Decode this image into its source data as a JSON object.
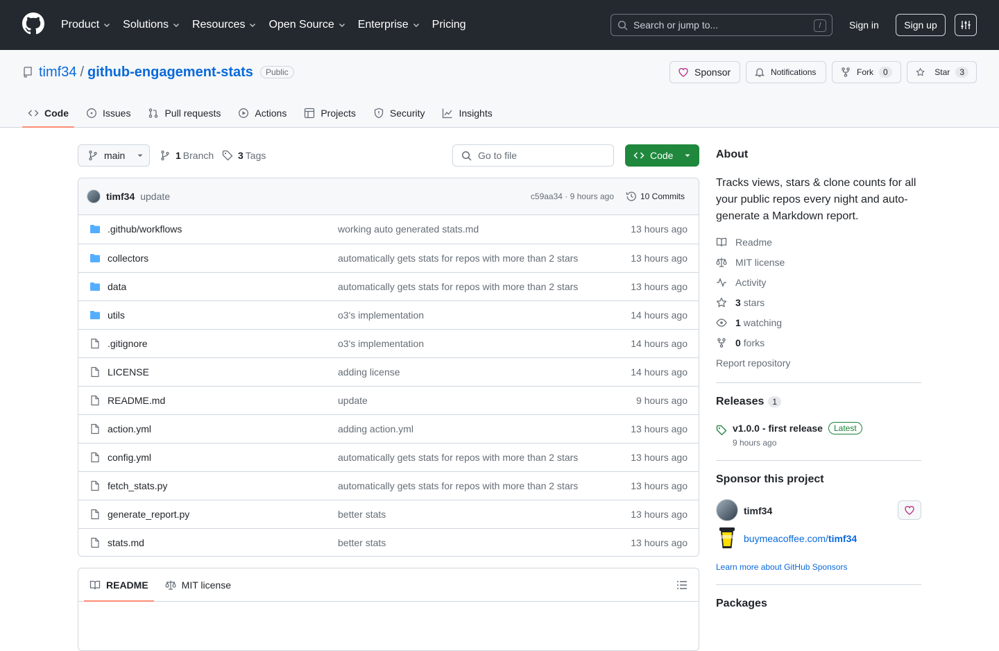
{
  "header": {
    "nav": [
      {
        "label": "Product",
        "has_menu": true
      },
      {
        "label": "Solutions",
        "has_menu": true
      },
      {
        "label": "Resources",
        "has_menu": true
      },
      {
        "label": "Open Source",
        "has_menu": true
      },
      {
        "label": "Enterprise",
        "has_menu": true
      },
      {
        "label": "Pricing",
        "has_menu": false
      }
    ],
    "search_placeholder": "Search or jump to...",
    "search_shortcut": "/",
    "sign_in": "Sign in",
    "sign_up": "Sign up"
  },
  "repo": {
    "owner": "timf34",
    "separator": "/",
    "name": "github-engagement-stats",
    "visibility": "Public",
    "sponsor_label": "Sponsor",
    "notifications_label": "Notifications",
    "fork_label": "Fork",
    "fork_count": "0",
    "star_label": "Star",
    "star_count": "3"
  },
  "tabs": [
    {
      "label": "Code",
      "icon": "code-icon",
      "active": true
    },
    {
      "label": "Issues",
      "icon": "issue-icon",
      "active": false
    },
    {
      "label": "Pull requests",
      "icon": "pull-request-icon",
      "active": false
    },
    {
      "label": "Actions",
      "icon": "play-icon",
      "active": false
    },
    {
      "label": "Projects",
      "icon": "table-icon",
      "active": false
    },
    {
      "label": "Security",
      "icon": "shield-icon",
      "active": false
    },
    {
      "label": "Insights",
      "icon": "graph-icon",
      "active": false
    }
  ],
  "toolbar": {
    "branch": "main",
    "branch_count": "1",
    "branch_label": "Branch",
    "tag_count": "3",
    "tag_label": "Tags",
    "go_to_file": "Go to file",
    "code_button": "Code"
  },
  "latest_commit": {
    "author": "timf34",
    "message": "update",
    "hash_and_time": "c59aa34 · 9 hours ago",
    "commits": "10 Commits"
  },
  "files": [
    {
      "name": ".github/workflows",
      "type": "dir",
      "message": "working auto generated stats.md",
      "age": "13 hours ago"
    },
    {
      "name": "collectors",
      "type": "dir",
      "message": "automatically gets stats for repos with more than 2 stars",
      "age": "13 hours ago"
    },
    {
      "name": "data",
      "type": "dir",
      "message": "automatically gets stats for repos with more than 2 stars",
      "age": "13 hours ago"
    },
    {
      "name": "utils",
      "type": "dir",
      "message": "o3's implementation",
      "age": "14 hours ago"
    },
    {
      "name": ".gitignore",
      "type": "file",
      "message": "o3's implementation",
      "age": "14 hours ago"
    },
    {
      "name": "LICENSE",
      "type": "file",
      "message": "adding license",
      "age": "14 hours ago"
    },
    {
      "name": "README.md",
      "type": "file",
      "message": "update",
      "age": "9 hours ago"
    },
    {
      "name": "action.yml",
      "type": "file",
      "message": "adding action.yml",
      "age": "13 hours ago"
    },
    {
      "name": "config.yml",
      "type": "file",
      "message": "automatically gets stats for repos with more than 2 stars",
      "age": "13 hours ago"
    },
    {
      "name": "fetch_stats.py",
      "type": "file",
      "message": "automatically gets stats for repos with more than 2 stars",
      "age": "13 hours ago"
    },
    {
      "name": "generate_report.py",
      "type": "file",
      "message": "better stats",
      "age": "13 hours ago"
    },
    {
      "name": "stats.md",
      "type": "file",
      "message": "better stats",
      "age": "13 hours ago"
    }
  ],
  "readme_tabs": {
    "readme": "README",
    "license": "MIT license"
  },
  "about": {
    "title": "About",
    "description": "Tracks views, stars & clone counts for all your public repos every night and auto-generate a Markdown report.",
    "readme": "Readme",
    "license": "MIT license",
    "activity": "Activity",
    "stars_count": "3",
    "stars_label": "stars",
    "watching_count": "1",
    "watching_label": "watching",
    "forks_count": "0",
    "forks_label": "forks",
    "report": "Report repository"
  },
  "releases": {
    "title": "Releases",
    "count": "1",
    "latest_name": "v1.0.0 - first release",
    "latest_badge": "Latest",
    "latest_time": "9 hours ago"
  },
  "sponsor": {
    "title": "Sponsor this project",
    "user": "timf34",
    "link_prefix": "buymeacoffee.com/",
    "link_user": "timf34",
    "learn_more": "Learn more about GitHub Sponsors"
  },
  "packages": {
    "title": "Packages"
  },
  "colors": {
    "header_bg": "#24292f",
    "accent_link": "#0969da",
    "code_button": "#1f883d",
    "active_tab_underline": "#fd8c73",
    "folder": "#54aeff",
    "sponsor_heart": "#bf3989"
  }
}
